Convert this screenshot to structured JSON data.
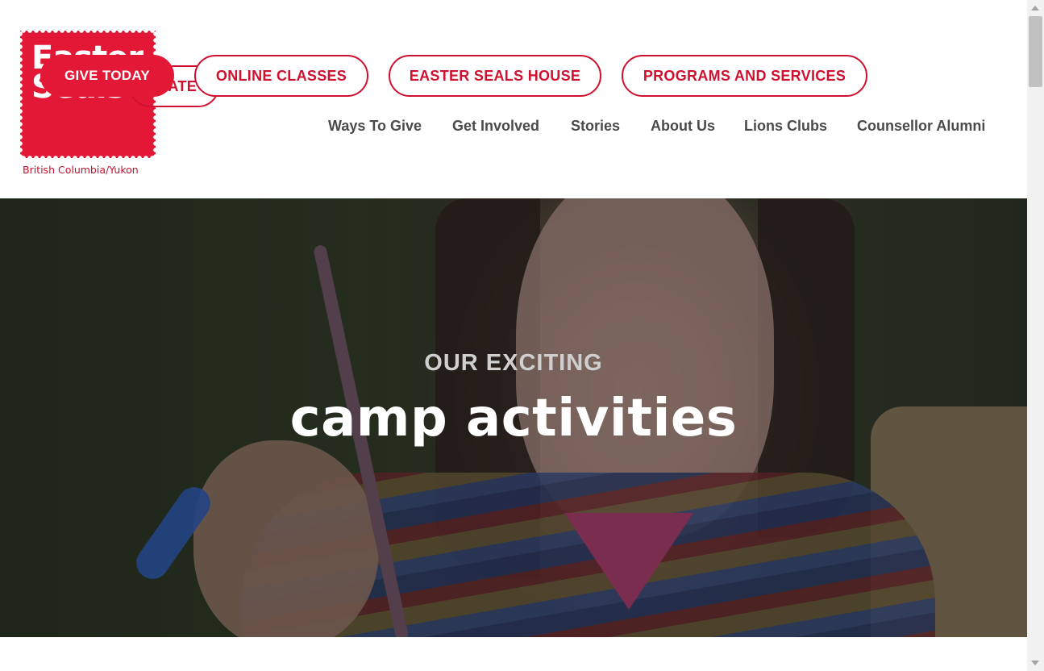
{
  "logo": {
    "word1": "Easter",
    "word2": "Seals",
    "subtitle": "British Columbia/Yukon",
    "brand_color": "#e31837"
  },
  "header_buttons": {
    "give_today": "GIVE TODAY",
    "donate": "DONATE",
    "online_classes": "ONLINE CLASSES",
    "easter_seals_house": "EASTER SEALS HOUSE",
    "programs_and_services": "PROGRAMS AND SERVICES"
  },
  "nav": {
    "items": [
      "Ways To Give",
      "Get Involved",
      "Stories",
      "About Us",
      "Lions Clubs",
      "Counsellor Alumni"
    ]
  },
  "hero": {
    "kicker": "OUR EXCITING",
    "headline": "camp activities"
  },
  "scrollbar": {
    "up_icon": "arrow-up-icon",
    "down_icon": "arrow-down-icon"
  }
}
